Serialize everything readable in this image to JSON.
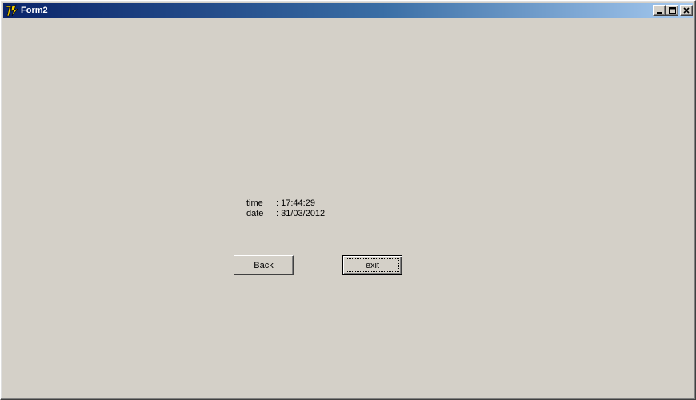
{
  "window": {
    "title": "Form2"
  },
  "icons": {
    "app": "lazarus-app-icon",
    "minimize": "minimize-icon",
    "maximize": "maximize-icon",
    "close": "close-icon"
  },
  "info": {
    "time_label": "time",
    "time_value": ": 17:44:29",
    "date_label": "date",
    "date_value": ": 31/03/2012"
  },
  "buttons": {
    "back_label": "Back",
    "exit_label": "exit"
  }
}
